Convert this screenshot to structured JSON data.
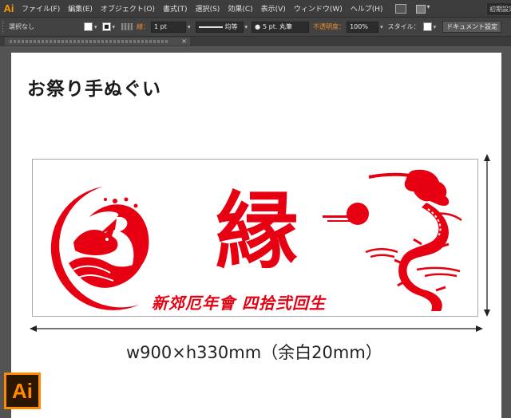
{
  "app": {
    "logo": "Ai",
    "workspace_label": "初期設定"
  },
  "menu": {
    "items": [
      "ファイル(F)",
      "編集(E)",
      "オブジェクト(O)",
      "書式(T)",
      "選択(S)",
      "効果(C)",
      "表示(V)",
      "ウィンドウ(W)",
      "ヘルプ(H)"
    ]
  },
  "control_bar": {
    "selection_status": "選択なし",
    "stroke_label": "線：",
    "stroke_weight": "1 pt",
    "stroke_profile": "均等",
    "brush": "5 pt. 丸筆",
    "opacity_label": "不透明度：",
    "opacity_value": "100%",
    "style_label": "スタイル：",
    "document_setup_button": "ドキュメント設定"
  },
  "canvas": {
    "title": "お祭り手ぬぐい",
    "main_kanji": "縁",
    "caption": "新郊厄年會 四拾弐回生",
    "size_label": "w900×h330mm（余白20mm）"
  },
  "colors": {
    "accent_red": "#e60012",
    "illustrator_orange": "#ff8a00"
  },
  "icons": {
    "menu_bar": [
      "screen-mode-icon",
      "arrange-documents-icon"
    ],
    "artwork": [
      "rabbit-wave-emblem-icon",
      "rising-sun-icon",
      "dragon-icon",
      "width-arrow-icon",
      "height-arrow-icon"
    ]
  }
}
